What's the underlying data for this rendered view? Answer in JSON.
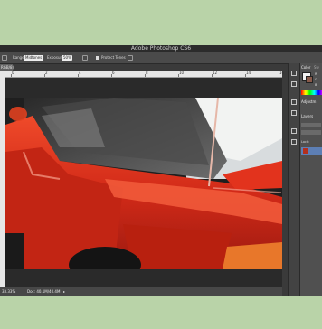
{
  "app": {
    "title": "Adobe Photoshop CS6",
    "document_tab": "RGB/8)"
  },
  "options_bar": {
    "range_label": "Range:",
    "range_value": "Midtones",
    "exposure_label": "Exposure:",
    "exposure_value": "50%",
    "protect_tones_label": "Protect Tones"
  },
  "ruler": {
    "ticks": [
      "0",
      "2",
      "4",
      "6",
      "8",
      "10",
      "12",
      "14",
      "16"
    ]
  },
  "status": {
    "zoom": "33.33%",
    "doc_info": "Doc: 40.1M/40.4M"
  },
  "panels": {
    "color_tab": "Color",
    "swatches_tab": "Sw",
    "adjustments_tab": "Adjustm",
    "layers_tab": "Layers",
    "lock_label": "Lock:",
    "channel_r": "R",
    "channel_g": "G",
    "channel_b": "B"
  },
  "colors": {
    "app_bg": "#3a3a3a",
    "outer_bg": "#b9d3a8",
    "car_red": "#d9301c",
    "canvas_gray": "#2a2a2a"
  },
  "icons": {
    "airbrush": "airbrush-icon",
    "pressure": "pressure-icon",
    "tablet": "tablet-pressure-icon"
  }
}
